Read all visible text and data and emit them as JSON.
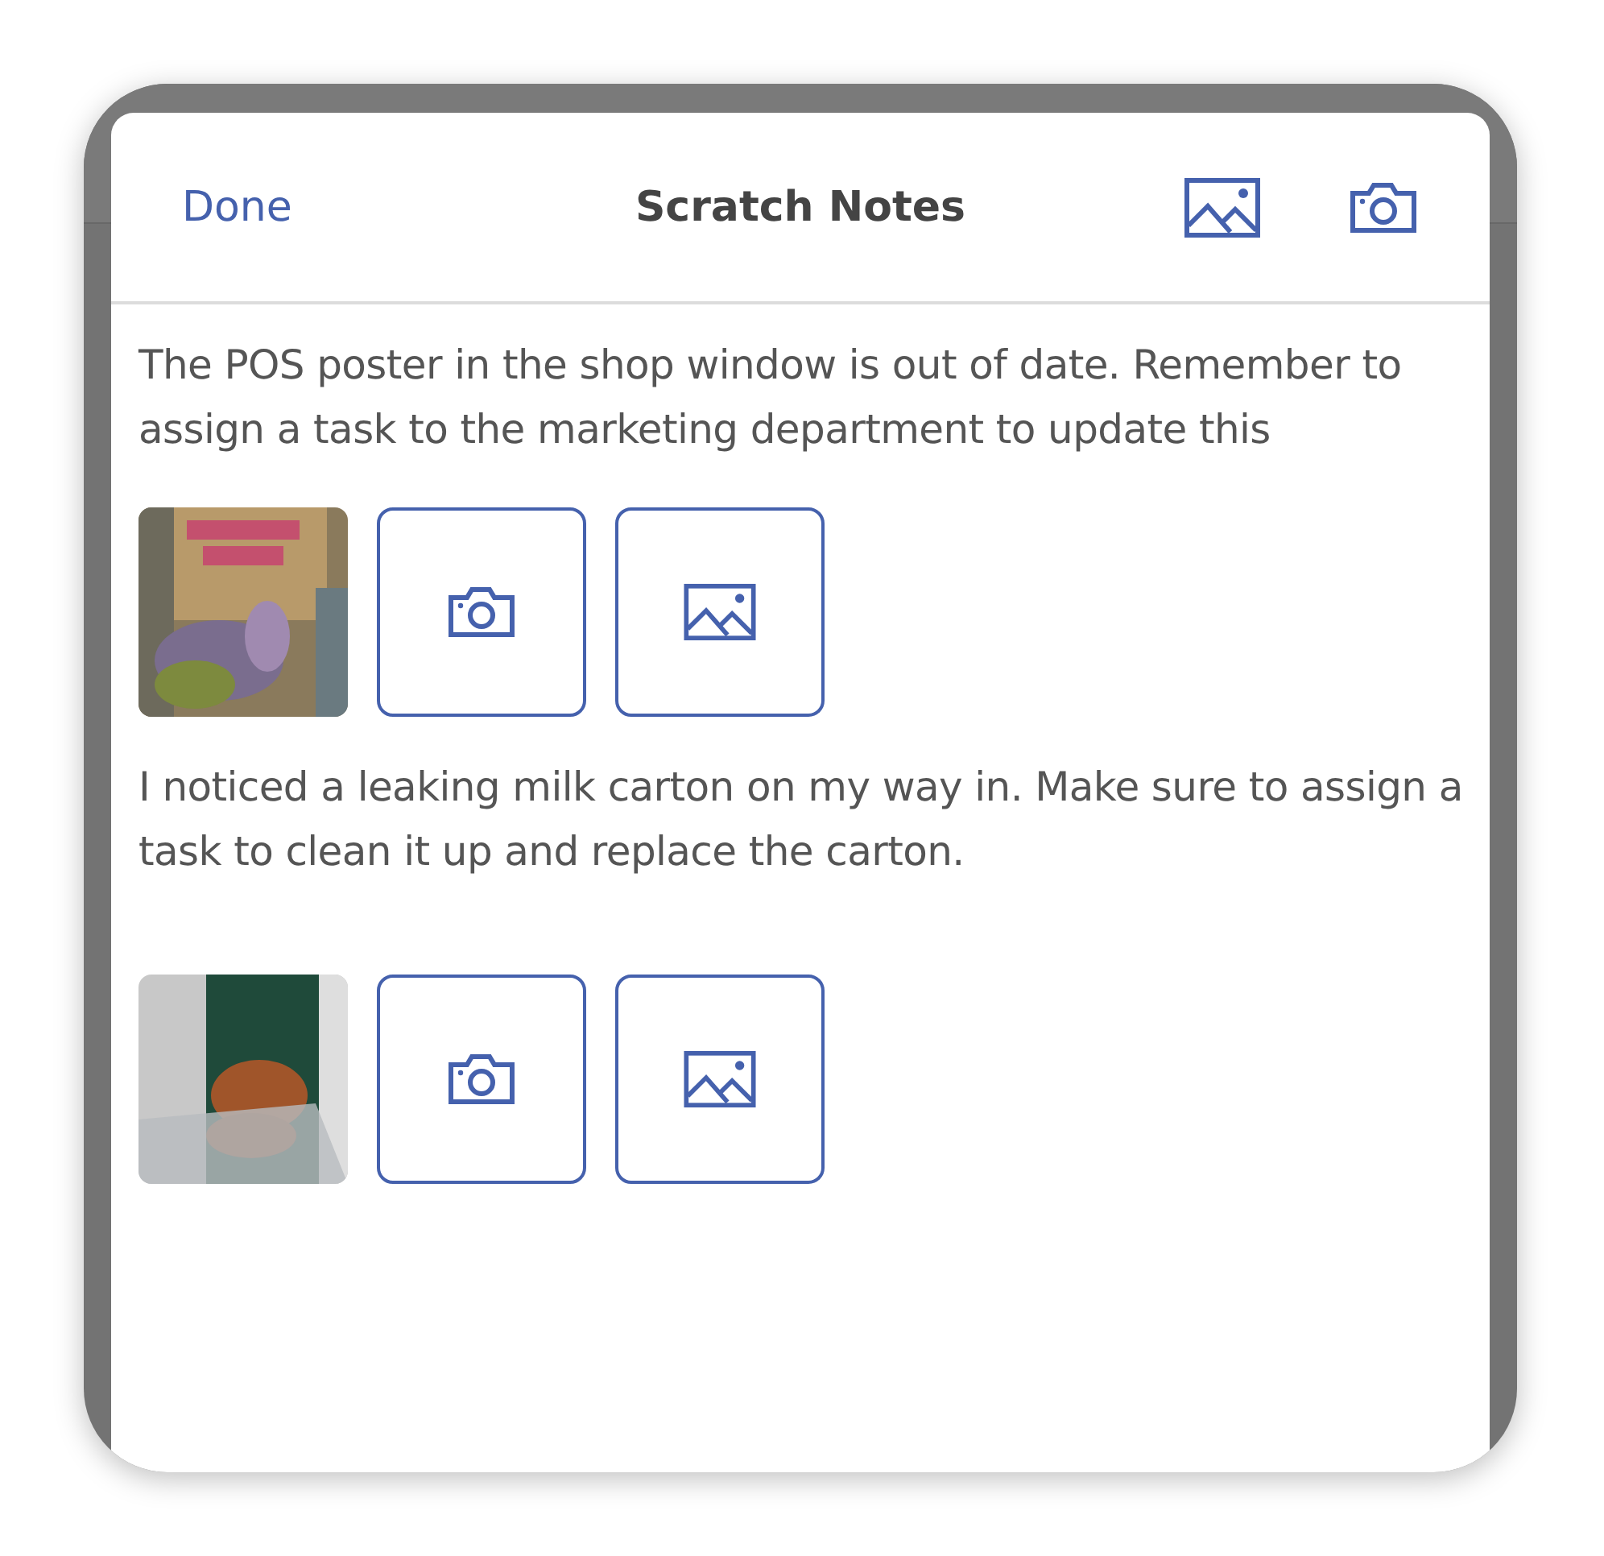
{
  "header": {
    "done": "Done",
    "title": "Scratch Notes"
  },
  "notes": [
    {
      "text": "The POS poster in the shop window is out of date. Remember to assign a task to the marketing department to update this"
    },
    {
      "text": "I noticed a leaking milk carton on my way in. Make sure to assign a task to clean it up and replace the carton."
    }
  ]
}
